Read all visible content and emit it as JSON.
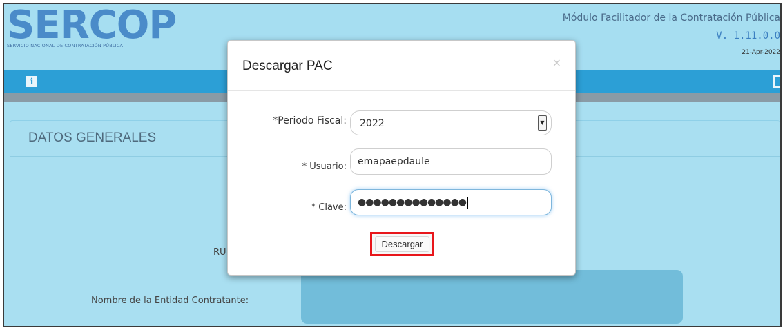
{
  "header": {
    "logo_text": "SERCOP",
    "logo_subtitle": "SERVICIO NACIONAL DE CONTRATACIÓN PÚBLICA",
    "app_title": "Módulo Facilitador de la Contratación Pública",
    "version": "V. 1.11.0.0",
    "date": "21-Apr-2022"
  },
  "toolbar": {
    "info_icon_glyph": "i"
  },
  "panel": {
    "title": "DATOS GENERALES",
    "ruc_label": "RU",
    "entidad_label": "Nombre de la Entidad Contratante:"
  },
  "modal": {
    "title": "Descargar PAC",
    "close_label": "×",
    "periodo_label": "*Periodo Fiscal:",
    "periodo_value": "2022",
    "select_arrow": "▼",
    "usuario_label": "* Usuario:",
    "usuario_value": "emapaepdaule",
    "clave_label": "* Clave:",
    "clave_value": "●●●●●●●●●●●●●●",
    "download_label": "Descargar"
  },
  "colors": {
    "accent": "#2c9fd6",
    "background": "#a9dff1",
    "highlight": "#e8161b"
  }
}
